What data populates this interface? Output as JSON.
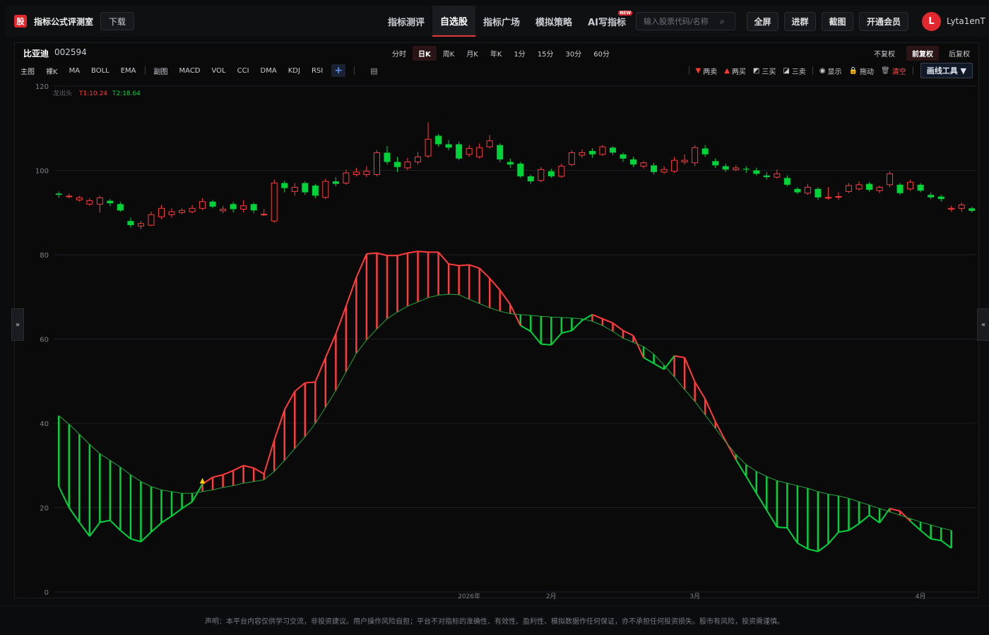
{
  "brand": {
    "logo_char": "股",
    "name": "指标公式评测室",
    "download": "下载"
  },
  "nav": [
    {
      "label": "指标测评",
      "active": false
    },
    {
      "label": "自选股",
      "active": true
    },
    {
      "label": "指标广场",
      "active": false
    },
    {
      "label": "模拟策略",
      "active": false
    },
    {
      "label": "AI写指标",
      "active": false,
      "badge": "NEW"
    }
  ],
  "search": {
    "placeholder": "输入股票代码/名称",
    "icon": "search-icon"
  },
  "top_buttons": [
    "全屏",
    "进群",
    "截图",
    "开通会员"
  ],
  "user": {
    "initial": "L",
    "name": "Lyta1enT"
  },
  "stock": {
    "name": "比亚迪",
    "code": "002594"
  },
  "periods": [
    {
      "label": "分时",
      "active": false
    },
    {
      "label": "日K",
      "active": true
    },
    {
      "label": "周K",
      "active": false
    },
    {
      "label": "月K",
      "active": false
    },
    {
      "label": "年K",
      "active": false
    },
    {
      "label": "1分",
      "active": false
    },
    {
      "label": "15分",
      "active": false
    },
    {
      "label": "30分",
      "active": false
    },
    {
      "label": "60分",
      "active": false
    }
  ],
  "adjust": [
    {
      "label": "不复权",
      "active": false
    },
    {
      "label": "前复权",
      "active": true
    },
    {
      "label": "后复权",
      "active": false
    }
  ],
  "main_indicators": [
    "主图",
    "裸K",
    "MA",
    "BOLL",
    "EMA"
  ],
  "sub_indicators": [
    "副图",
    "MACD",
    "VOL",
    "CCI",
    "DMA",
    "KDJ",
    "RSI"
  ],
  "plus_label": "+",
  "tools": [
    {
      "label": "两卖",
      "glyph": "▼",
      "color": "#ff3b30"
    },
    {
      "label": "两买",
      "glyph": "▲",
      "color": "#ff3b30"
    },
    {
      "label": "三买",
      "glyph": "◩",
      "color": "#dfe3ea"
    },
    {
      "label": "三卖",
      "glyph": "◪",
      "color": "#dfe3ea"
    },
    {
      "label": "显示",
      "glyph": "◉",
      "color": "#dfe3ea"
    },
    {
      "label": "拖动",
      "glyph": "🔒",
      "color": "#f0c040"
    },
    {
      "label": "清空",
      "glyph": "🗑",
      "color": "#a0a3aa"
    }
  ],
  "draw_tools": "画线工具 ▼",
  "side_tabs": {
    "left": "»",
    "right": "«"
  },
  "legend": {
    "name": "龙出头",
    "t1": "T1:10.24",
    "t2": "T2:18.64"
  },
  "footer": "声明：本平台内容仅供学习交流，非投资建议。用户操作风险自担；平台不对指标的准确性、有效性、盈利性、模拟数据作任何保证，亦不承担任何投资损失。股市有风险，投资需谨慎。",
  "chart_data": {
    "type": "candlestick",
    "ylim": [
      0,
      120
    ],
    "yticks": [
      0,
      20,
      40,
      60,
      80,
      100,
      120
    ],
    "xlabels": [
      {
        "label": "2026年",
        "index": 40
      },
      {
        "label": "2月",
        "index": 48
      },
      {
        "label": "3月",
        "index": 62
      },
      {
        "label": "4月",
        "index": 84
      }
    ],
    "up_color": "#ff3b3b",
    "down_color": "#00d23a",
    "candles": [
      [
        94.5,
        94.2,
        95.0,
        93.5
      ],
      [
        93.8,
        93.9,
        94.5,
        93.4
      ],
      [
        93.0,
        93.5,
        94.0,
        92.6
      ],
      [
        92.0,
        92.8,
        93.4,
        91.6
      ],
      [
        92.0,
        93.5,
        94.0,
        90.0
      ],
      [
        92.8,
        92.2,
        93.2,
        91.5
      ],
      [
        92.0,
        90.5,
        92.5,
        90.2
      ],
      [
        88.0,
        87.0,
        88.8,
        86.4
      ],
      [
        86.8,
        87.4,
        88.0,
        86.0
      ],
      [
        87.0,
        89.5,
        90.2,
        86.8
      ],
      [
        89.0,
        91.0,
        91.8,
        88.4
      ],
      [
        89.5,
        90.2,
        91.0,
        88.8
      ],
      [
        90.0,
        90.5,
        91.0,
        89.6
      ],
      [
        90.2,
        91.0,
        91.8,
        89.8
      ],
      [
        91.0,
        92.6,
        93.4,
        90.6
      ],
      [
        92.6,
        91.4,
        93.0,
        91.0
      ],
      [
        90.4,
        90.8,
        91.6,
        89.8
      ],
      [
        92.0,
        90.8,
        92.5,
        90.0
      ],
      [
        90.8,
        91.6,
        93.0,
        90.0
      ],
      [
        92.0,
        90.5,
        92.4,
        89.8
      ],
      [
        89.6,
        89.6,
        90.8,
        89.2
      ],
      [
        88.0,
        97.0,
        97.8,
        87.6
      ],
      [
        97.0,
        95.8,
        97.5,
        94.8
      ],
      [
        95.0,
        96.0,
        97.0,
        94.0
      ],
      [
        97.0,
        94.8,
        97.4,
        94.2
      ],
      [
        96.4,
        94.0,
        96.8,
        93.4
      ],
      [
        93.6,
        97.4,
        98.0,
        93.2
      ],
      [
        97.4,
        96.8,
        98.4,
        96.2
      ],
      [
        97.0,
        99.4,
        100.2,
        96.6
      ],
      [
        99.0,
        99.6,
        100.6,
        98.6
      ],
      [
        99.0,
        99.8,
        101.0,
        98.4
      ],
      [
        99.0,
        104.2,
        104.8,
        98.6
      ],
      [
        104.2,
        102.0,
        105.8,
        101.4
      ],
      [
        102.0,
        100.8,
        103.2,
        99.6
      ],
      [
        100.6,
        102.0,
        103.0,
        100.0
      ],
      [
        102.0,
        103.2,
        104.4,
        101.4
      ],
      [
        103.4,
        107.4,
        111.4,
        103.0
      ],
      [
        108.2,
        106.2,
        108.6,
        105.6
      ],
      [
        106.2,
        105.4,
        107.2,
        104.8
      ],
      [
        106.2,
        102.8,
        106.8,
        102.4
      ],
      [
        103.8,
        105.2,
        106.0,
        103.2
      ],
      [
        103.2,
        105.4,
        106.4,
        102.8
      ],
      [
        105.6,
        107.0,
        108.4,
        105.2
      ],
      [
        106.0,
        102.6,
        106.4,
        102.0
      ],
      [
        102.0,
        101.4,
        102.8,
        100.6
      ],
      [
        101.6,
        98.6,
        102.0,
        98.2
      ],
      [
        98.6,
        97.4,
        99.0,
        96.8
      ],
      [
        97.6,
        100.2,
        100.8,
        97.2
      ],
      [
        99.8,
        98.6,
        100.4,
        98.2
      ],
      [
        98.6,
        101.0,
        101.6,
        98.2
      ],
      [
        101.4,
        104.2,
        104.8,
        101.0
      ],
      [
        103.6,
        104.2,
        105.0,
        103.0
      ],
      [
        104.6,
        103.8,
        105.2,
        103.0
      ],
      [
        103.8,
        105.6,
        106.0,
        103.4
      ],
      [
        105.4,
        104.2,
        105.8,
        103.6
      ],
      [
        103.8,
        102.8,
        104.2,
        102.0
      ],
      [
        102.6,
        101.4,
        103.2,
        100.8
      ],
      [
        101.0,
        101.8,
        102.2,
        100.4
      ],
      [
        101.2,
        99.6,
        101.8,
        99.0
      ],
      [
        99.6,
        100.2,
        101.0,
        99.2
      ],
      [
        99.8,
        102.4,
        103.2,
        99.4
      ],
      [
        102.0,
        102.4,
        103.8,
        101.4
      ],
      [
        101.8,
        105.4,
        106.0,
        101.0
      ],
      [
        105.2,
        103.8,
        106.0,
        103.2
      ],
      [
        102.2,
        101.2,
        102.8,
        100.6
      ],
      [
        101.0,
        100.2,
        101.6,
        99.6
      ],
      [
        100.2,
        100.6,
        101.2,
        99.8
      ],
      [
        100.4,
        100.2,
        101.0,
        99.4
      ],
      [
        100.0,
        99.2,
        100.6,
        98.8
      ],
      [
        98.8,
        98.4,
        99.6,
        97.8
      ],
      [
        98.4,
        99.2,
        100.2,
        98.0
      ],
      [
        98.2,
        96.6,
        98.8,
        96.2
      ],
      [
        95.6,
        94.8,
        96.0,
        94.4
      ],
      [
        94.6,
        96.0,
        96.8,
        94.2
      ],
      [
        95.6,
        93.6,
        96.0,
        93.0
      ],
      [
        93.6,
        93.6,
        96.0,
        93.0
      ],
      [
        93.8,
        93.8,
        94.8,
        93.0
      ],
      [
        95.0,
        96.4,
        97.0,
        94.6
      ],
      [
        95.6,
        96.6,
        97.4,
        95.2
      ],
      [
        96.8,
        95.4,
        97.2,
        95.0
      ],
      [
        95.2,
        96.0,
        96.4,
        94.6
      ],
      [
        96.6,
        99.2,
        99.8,
        96.0
      ],
      [
        96.6,
        94.6,
        97.0,
        94.2
      ],
      [
        95.6,
        97.2,
        97.8,
        95.2
      ],
      [
        96.6,
        95.2,
        97.0,
        94.8
      ],
      [
        94.2,
        93.6,
        94.8,
        93.2
      ],
      [
        93.8,
        93.2,
        94.2,
        92.6
      ],
      [
        90.8,
        91.0,
        91.6,
        90.2
      ],
      [
        91.0,
        91.8,
        92.4,
        90.2
      ],
      [
        91.0,
        90.4,
        91.4,
        90.0
      ]
    ],
    "indicator": {
      "name": "龙出头",
      "line_a": [
        25,
        20,
        16.5,
        13.2,
        16.5,
        17,
        14.6,
        12.6,
        11.9,
        14.2,
        16.4,
        18,
        19.8,
        21.4,
        25.6,
        27.2,
        27.8,
        28.8,
        30,
        29.4,
        28,
        36,
        43.2,
        47.6,
        49.6,
        49.8,
        55.6,
        61.2,
        67.8,
        74.6,
        80.2,
        80.4,
        79.8,
        79.8,
        80.4,
        80.8,
        80.6,
        80.6,
        77.8,
        77.4,
        77.6,
        76.8,
        74.4,
        71.6,
        68.2,
        63.2,
        61.8,
        58.8,
        58.6,
        61.4,
        62,
        64.4,
        65.8,
        64.8,
        63.8,
        62,
        60.8,
        55.6,
        54.2,
        52.8,
        56,
        55.6,
        49.8,
        45.8,
        40.4,
        35.8,
        31.4,
        27.4,
        23.4,
        19.4,
        15.4,
        15.2,
        11.6,
        10.2,
        9.6,
        11.4,
        14.2,
        14.6,
        16.2,
        18.2,
        16.4,
        19.8,
        19.2,
        16.8,
        14.6,
        12.6,
        12.2,
        10.4
      ],
      "line_b": [
        41.8,
        39.8,
        37.4,
        35,
        32.8,
        31.2,
        29.6,
        27.8,
        26.2,
        25,
        24.2,
        23.8,
        23.4,
        23.4,
        23.8,
        24.2,
        24.8,
        25.2,
        25.8,
        26.2,
        26.6,
        28.6,
        31.2,
        34,
        36.8,
        40,
        43.8,
        47.8,
        52.2,
        56.6,
        59.8,
        62.4,
        64.8,
        66.4,
        67.8,
        68.8,
        69.8,
        70.4,
        70.6,
        70.5,
        69.4,
        68.4,
        67.4,
        66.6,
        66,
        65.8,
        65.6,
        65.4,
        65.2,
        65.1,
        65,
        64.8,
        64.2,
        63.2,
        61.8,
        60.2,
        59.2,
        58.2,
        56.4,
        53.8,
        51,
        48,
        45.2,
        42,
        38.8,
        35.6,
        32.6,
        30.2,
        28.6,
        27.4,
        26.4,
        25.8,
        25.2,
        24.6,
        23.8,
        23.2,
        22.8,
        22.2,
        21.4,
        20.6,
        19.8,
        19.0,
        18.2,
        17.4,
        16.6,
        15.9,
        15.2,
        14.6
      ],
      "start_index": 0,
      "marker": {
        "glyph": "▲",
        "index": 14
      }
    }
  }
}
